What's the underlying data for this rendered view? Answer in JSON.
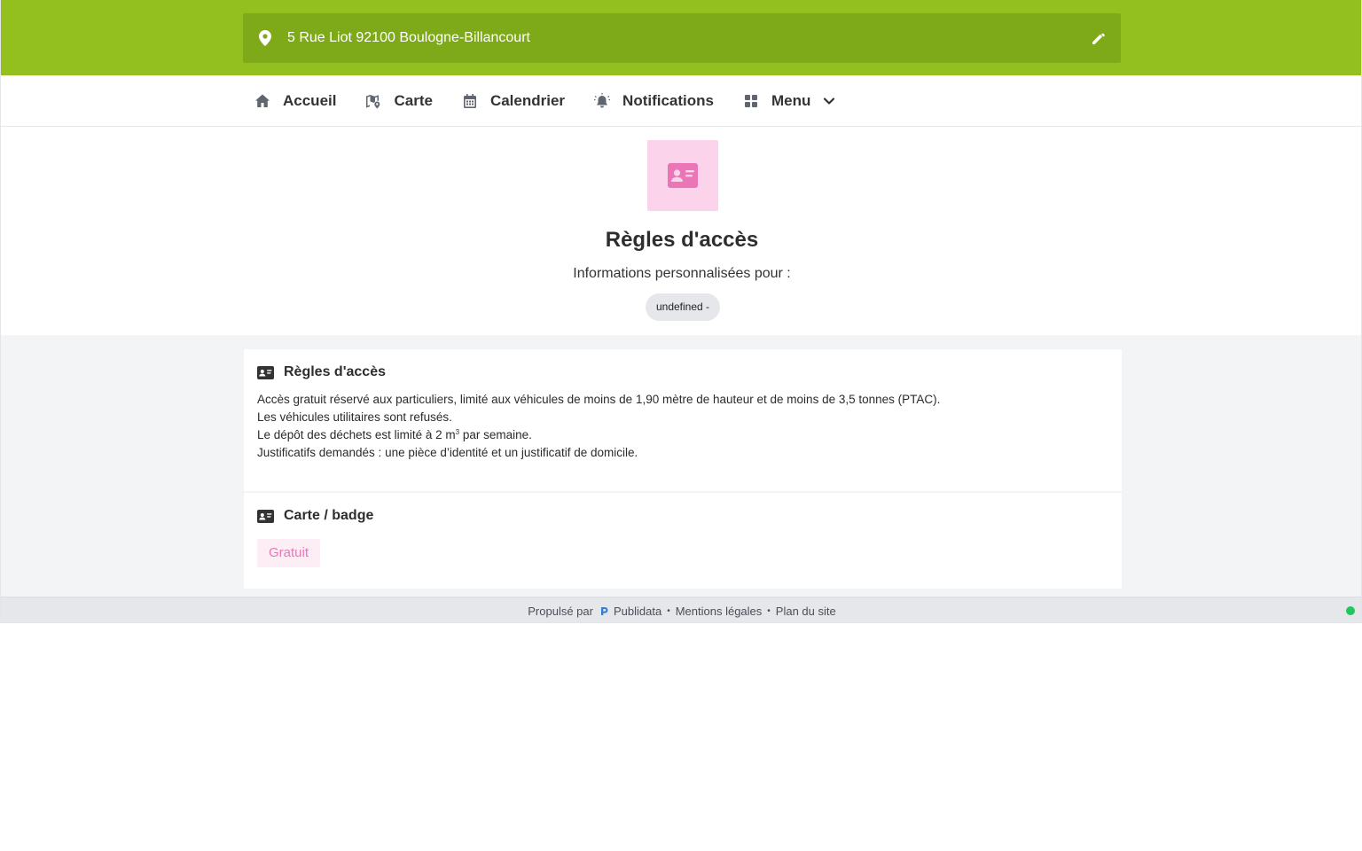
{
  "header": {
    "address": "5 Rue Liot 92100 Boulogne-Billancourt"
  },
  "nav": {
    "items": [
      {
        "label": "Accueil",
        "icon": "home-icon"
      },
      {
        "label": "Carte",
        "icon": "map-icon"
      },
      {
        "label": "Calendrier",
        "icon": "calendar-icon"
      },
      {
        "label": "Notifications",
        "icon": "bell-icon"
      },
      {
        "label": "Menu",
        "icon": "grid-icon"
      }
    ]
  },
  "hero": {
    "icon": "id-card-icon",
    "title": "Règles d'accès",
    "subtitle": "Informations personnalisées pour :",
    "chip": "undefined -"
  },
  "cards": {
    "access": {
      "title": "Règles d'accès",
      "line1": "Accès gratuit réservé aux particuliers, limité aux véhicules de moins de 1,90 mètre de hauteur et de moins de 3,5 tonnes (PTAC).",
      "line2": "Les véhicules utilitaires sont refusés.",
      "line3_before": "Le dépôt des déchets est limité à 2 m",
      "line3_sup": "3",
      "line3_after": " par semaine.",
      "line4": "Justificatifs demandés : une pièce d’identité et un justificatif de domicile."
    },
    "badge": {
      "title": "Carte / badge",
      "value": "Gratuit"
    }
  },
  "footer": {
    "powered": "Propulsé par",
    "brand": "Publidata",
    "legal": "Mentions légales",
    "sitemap": "Plan du site",
    "sep": "•"
  },
  "colors": {
    "brand_green": "#93c01f",
    "address_bg": "#7eaa1a",
    "accent_pink": "#ea76b8",
    "status_green": "#22c55e"
  }
}
